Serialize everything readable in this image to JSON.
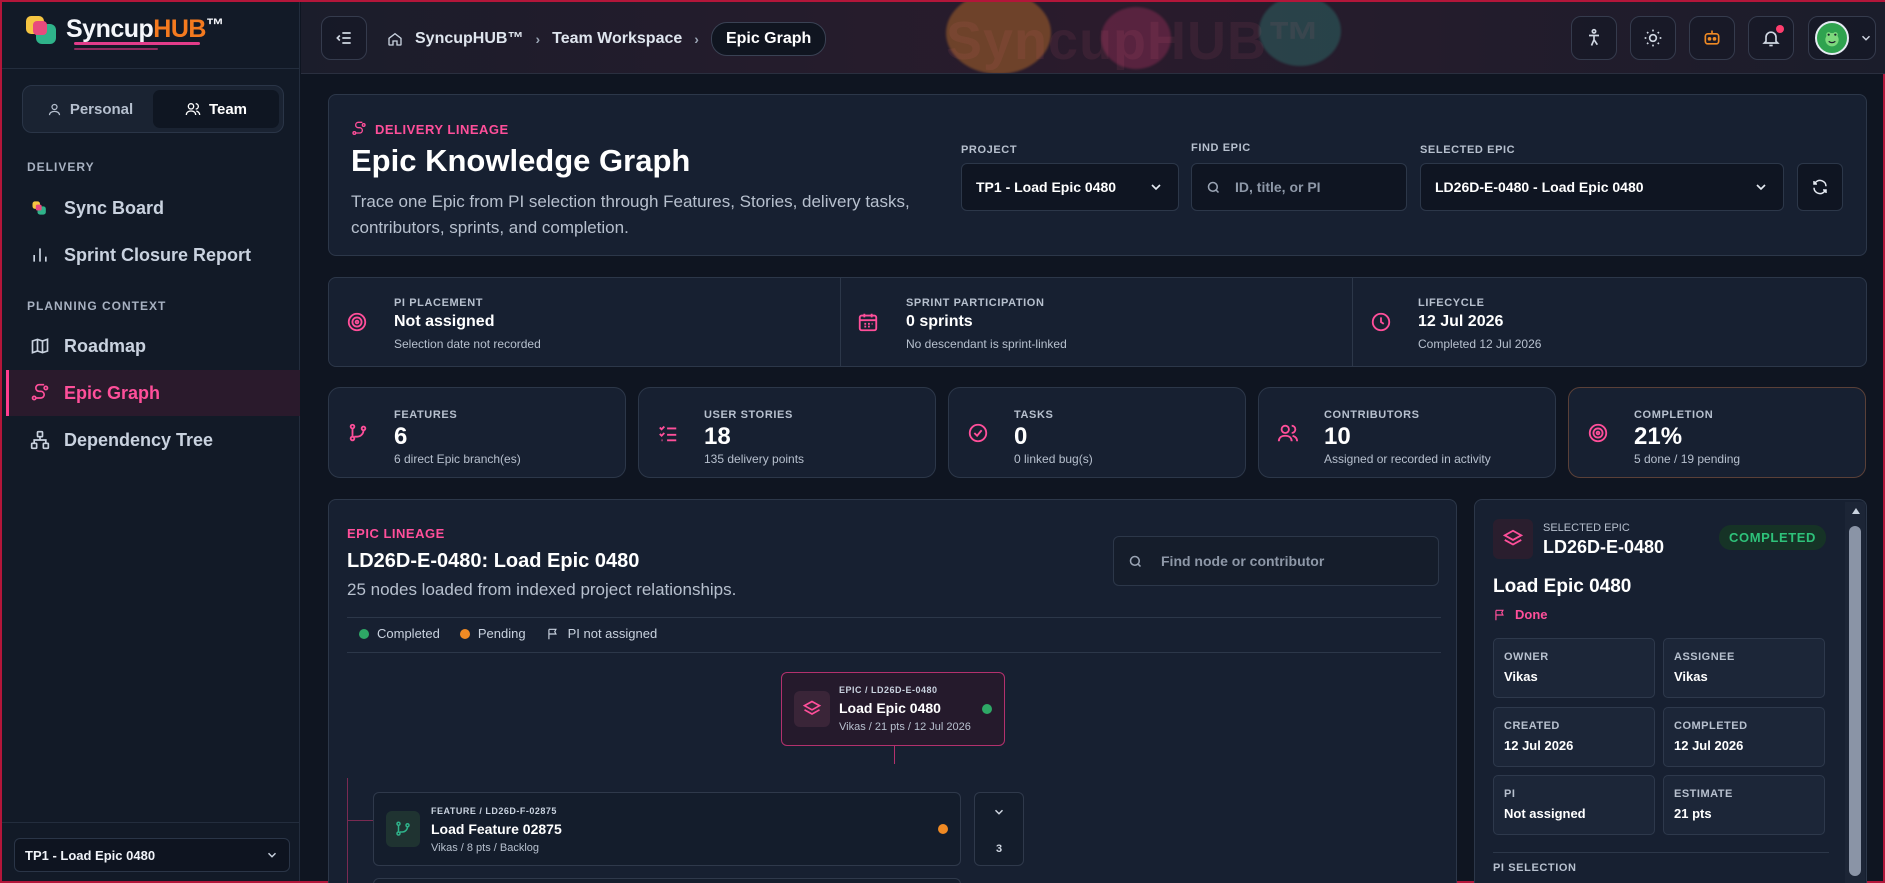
{
  "brand": {
    "name_main": "Syncup",
    "name_accent": "HUB",
    "tm": "™"
  },
  "sidebar": {
    "modes": [
      {
        "label": "Personal"
      },
      {
        "label": "Team"
      }
    ],
    "sections": [
      {
        "title": "DELIVERY"
      },
      {
        "title": "PLANNING CONTEXT"
      }
    ],
    "items": [
      {
        "label": "Sync Board"
      },
      {
        "label": "Sprint Closure Report"
      },
      {
        "label": "Roadmap"
      },
      {
        "label": "Epic Graph"
      },
      {
        "label": "Dependency Tree"
      }
    ],
    "project_select": "TP1 - Load Epic 0480"
  },
  "topbar": {
    "watermark": "SyncupHUB™",
    "breadcrumbs": [
      "SyncupHUB™",
      "Team Workspace",
      "Epic Graph"
    ]
  },
  "header": {
    "kicker": "DELIVERY LINEAGE",
    "title": "Epic Knowledge Graph",
    "description_line1": "Trace one Epic from PI selection through Features, Stories, delivery tasks,",
    "description_line2": "contributors, sprints, and completion.",
    "project_label": "PROJECT",
    "project_value": "TP1 - Load Epic 0480",
    "find_label": "FIND EPIC",
    "find_placeholder": "ID, title, or PI",
    "selected_label": "SELECTED EPIC",
    "selected_value": "LD26D-E-0480 - Load Epic 0480"
  },
  "summary": [
    {
      "label": "PI PLACEMENT",
      "value": "Not assigned",
      "sub": "Selection date not recorded"
    },
    {
      "label": "SPRINT PARTICIPATION",
      "value": "0 sprints",
      "sub": "No descendant is sprint-linked"
    },
    {
      "label": "LIFECYCLE",
      "value": "12 Jul 2026",
      "sub": "Completed 12 Jul 2026"
    }
  ],
  "metrics": [
    {
      "label": "FEATURES",
      "value": "6",
      "sub": "6 direct Epic branch(es)"
    },
    {
      "label": "USER STORIES",
      "value": "18",
      "sub": "135 delivery points"
    },
    {
      "label": "TASKS",
      "value": "0",
      "sub": "0 linked bug(s)"
    },
    {
      "label": "CONTRIBUTORS",
      "value": "10",
      "sub": "Assigned or recorded in activity"
    },
    {
      "label": "COMPLETION",
      "value": "21%",
      "sub": "5 done / 19 pending"
    }
  ],
  "lineage": {
    "kicker": "EPIC LINEAGE",
    "title": "LD26D-E-0480: Load Epic 0480",
    "subtitle": "25 nodes loaded from indexed project relationships.",
    "search_placeholder": "Find node or contributor",
    "legend": [
      "Completed",
      "Pending",
      "PI not assigned"
    ],
    "epic_node": {
      "kicker": "EPIC / LD26D-E-0480",
      "title": "Load Epic 0480",
      "meta": "Vikas / 21 pts / 12 Jul 2026"
    },
    "feature_node": {
      "kicker": "FEATURE / LD26D-F-02875",
      "title": "Load Feature 02875",
      "meta": "Vikas / 8 pts / Backlog",
      "children_count": "3"
    }
  },
  "details": {
    "kicker": "SELECTED EPIC",
    "id": "LD26D-E-0480",
    "status": "COMPLETED",
    "title": "Load Epic 0480",
    "state": "Done",
    "fields": [
      {
        "label": "OWNER",
        "value": "Vikas"
      },
      {
        "label": "ASSIGNEE",
        "value": "Vikas"
      },
      {
        "label": "CREATED",
        "value": "12 Jul 2026"
      },
      {
        "label": "COMPLETED",
        "value": "12 Jul 2026"
      },
      {
        "label": "PI",
        "value": "Not assigned"
      },
      {
        "label": "ESTIMATE",
        "value": "21 pts"
      }
    ],
    "pi_selection_label": "PI SELECTION"
  },
  "colors": {
    "accent": "#ff4f9a",
    "completed": "#2ea866",
    "pending": "#f08a24",
    "brand_orange": "#f47a1f"
  }
}
